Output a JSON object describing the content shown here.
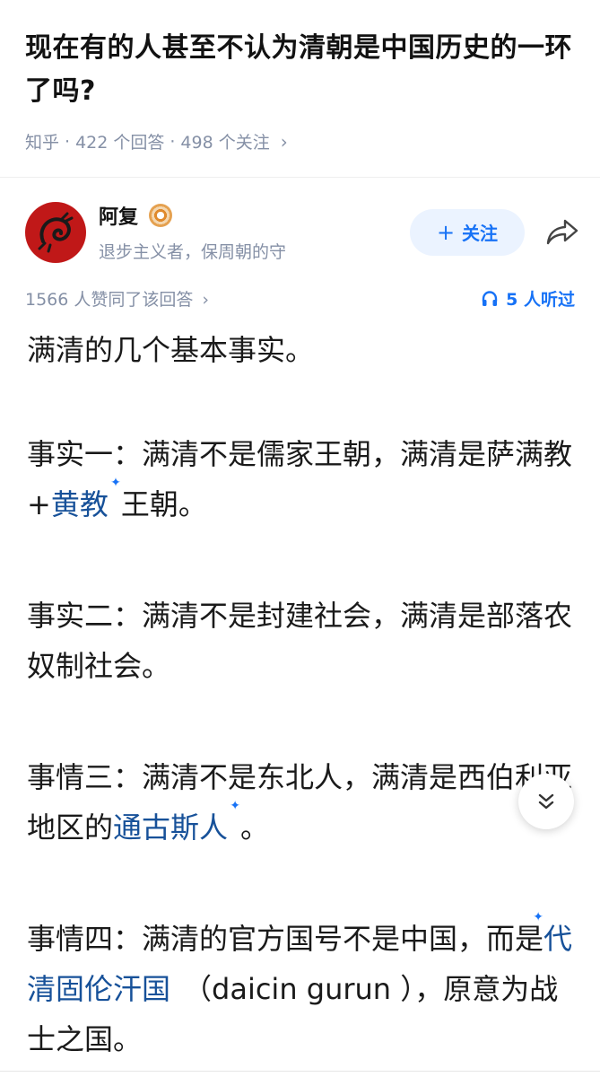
{
  "question": {
    "title": "现在有的人甚至不认为清朝是中国历史的一环了吗?",
    "source": "知乎",
    "answers": "422 个回答",
    "followers": "498 个关注",
    "sep": "·"
  },
  "author": {
    "name": "阿复",
    "description": "退步主义者，保周朝的守",
    "follow_label": "关注",
    "follow_plus": "+"
  },
  "stats": {
    "votes": "1566 人赞同了该回答",
    "listened": "5 人听过"
  },
  "content": {
    "p1": "满清的几个基本事实。",
    "p2_a": "事实一：满清不是儒家王朝，满清是萨满教+",
    "p2_link": "黄教",
    "p2_b": "王朝。",
    "p3": "事实二：满清不是封建社会，满清是部落农奴制社会。",
    "p4_a": "事情三：满清不是东北人，满清是西伯利亚地区的",
    "p4_link": "通古斯人",
    "p4_b": "。",
    "p5_a": "事情四：满清的官方国号不是中国，而是",
    "p5_link": "代清固伦汗国",
    "p5_b": "（daicin gurun ），原意为战士之国。"
  },
  "icons": {
    "chevron": "›",
    "spark": "✦",
    "accent": "#1772f6",
    "link_color": "#175199"
  }
}
